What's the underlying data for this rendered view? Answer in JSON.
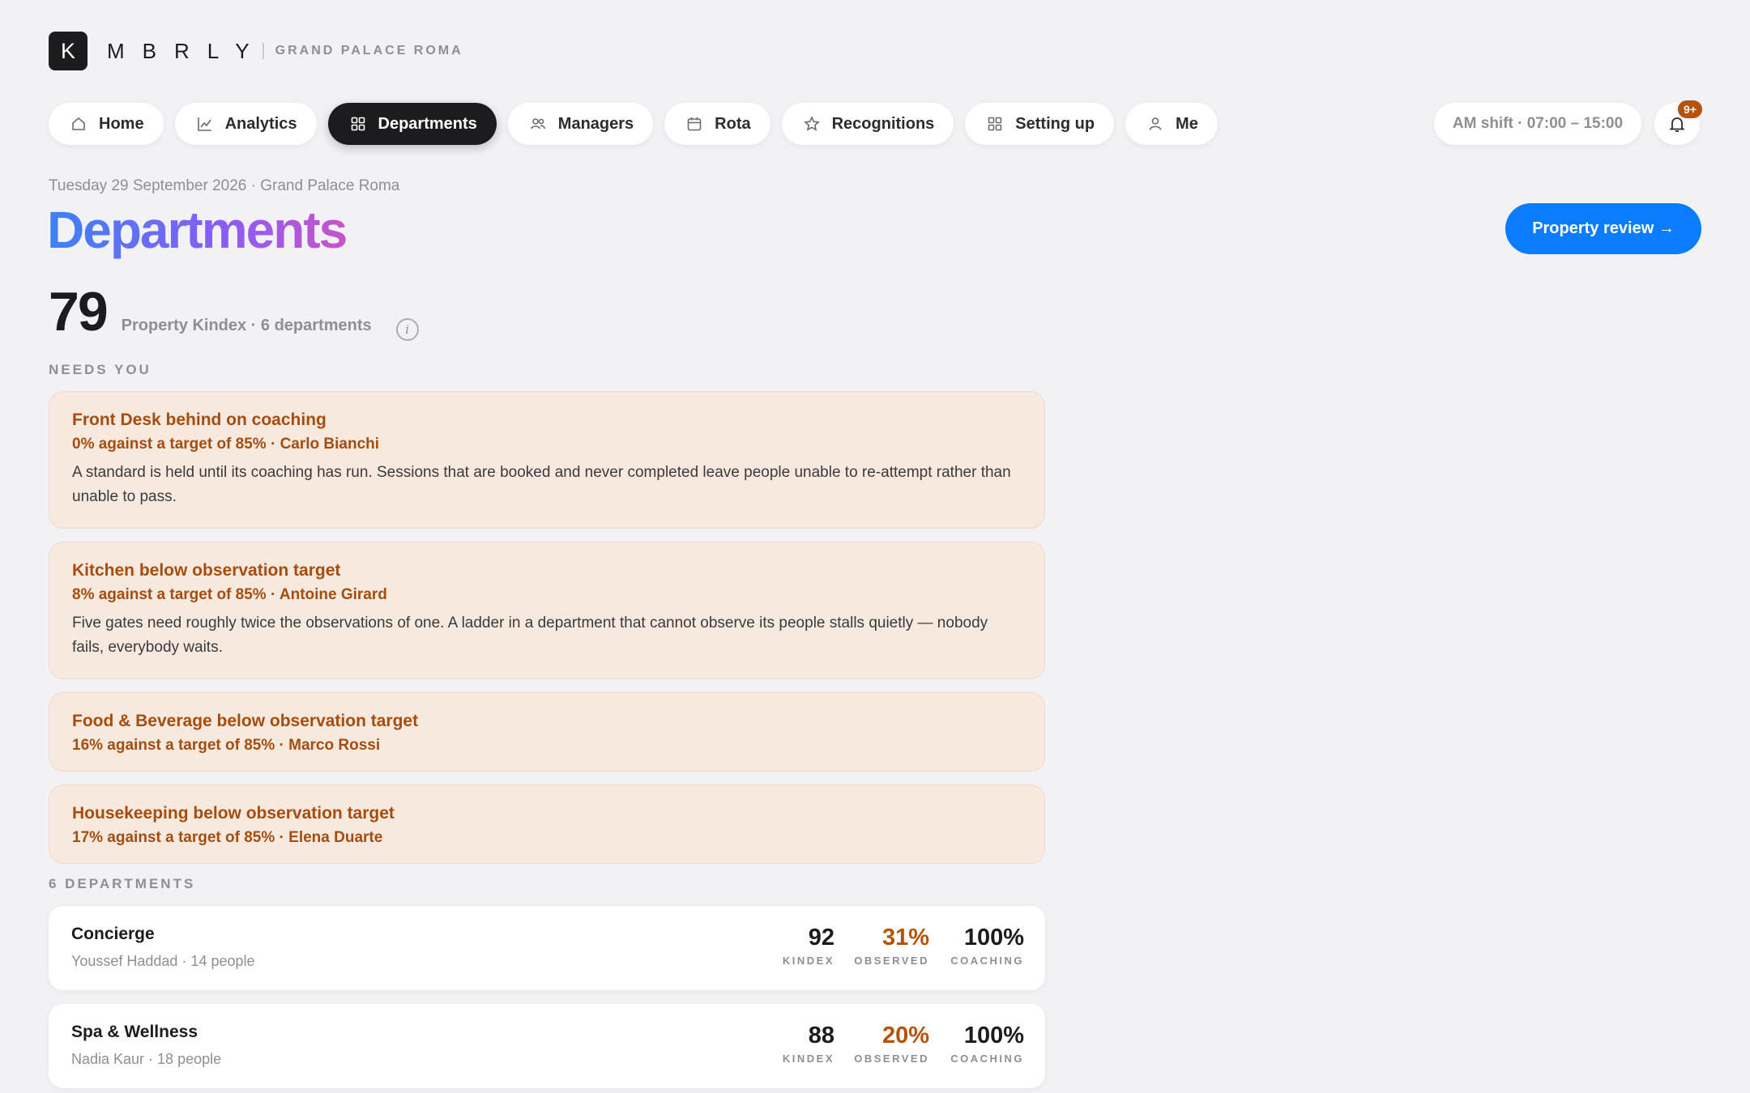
{
  "brand": {
    "logo_letter": "K",
    "wordmark": "MBRLY",
    "property": "GRAND PALACE ROMA"
  },
  "nav": {
    "items": [
      {
        "label": "Home",
        "icon": "home-icon",
        "active": false
      },
      {
        "label": "Analytics",
        "icon": "chart-icon",
        "active": false
      },
      {
        "label": "Departments",
        "icon": "grid-icon",
        "active": true
      },
      {
        "label": "Managers",
        "icon": "people-icon",
        "active": false
      },
      {
        "label": "Rota",
        "icon": "calendar-icon",
        "active": false
      },
      {
        "label": "Recognitions",
        "icon": "star-icon",
        "active": false
      },
      {
        "label": "Setting up",
        "icon": "grid-icon",
        "active": false
      },
      {
        "label": "Me",
        "icon": "person-icon",
        "active": false
      }
    ],
    "shift": "AM shift · 07:00 – 15:00",
    "notifications_badge": "9+"
  },
  "header": {
    "dateline": "Tuesday 29 September 2026 · Grand Palace Roma",
    "title": "Departments",
    "review_button": "Property review →"
  },
  "summary": {
    "kindex": "79",
    "label": "Property Kindex · 6 departments",
    "info_glyph": "i"
  },
  "needs_you": {
    "label": "NEEDS YOU",
    "alerts": [
      {
        "title": "Front Desk behind on coaching",
        "subtitle": "0% against a target of 85% · Carlo Bianchi",
        "body": "A standard is held until its coaching has run. Sessions that are booked and never completed leave people unable to re-attempt rather than unable to pass."
      },
      {
        "title": "Kitchen below observation target",
        "subtitle": "8% against a target of 85% · Antoine Girard",
        "body": "Five gates need roughly twice the observations of one. A ladder in a department that cannot observe its people stalls quietly — nobody fails, everybody waits."
      },
      {
        "title": "Food & Beverage below observation target",
        "subtitle": "16% against a target of 85% · Marco Rossi",
        "body": ""
      },
      {
        "title": "Housekeeping below observation target",
        "subtitle": "17% against a target of 85% · Elena Duarte",
        "body": ""
      }
    ]
  },
  "departments": {
    "label": "6 DEPARTMENTS",
    "metric_labels": {
      "kindex": "KINDEX",
      "observed": "OBSERVED",
      "coaching": "COACHING"
    },
    "items": [
      {
        "name": "Concierge",
        "meta": "Youssef Haddad · 14 people",
        "kindex": "92",
        "observed": "31%",
        "coaching": "100%"
      },
      {
        "name": "Spa & Wellness",
        "meta": "Nadia Kaur · 18 people",
        "kindex": "88",
        "observed": "20%",
        "coaching": "100%"
      }
    ]
  },
  "colors": {
    "accent": "#0a7cff",
    "warning": "#b45309",
    "alert_bg": "#f8e9df",
    "title_gradient": [
      "#3b82f6",
      "#8b5cf6",
      "#c855c8"
    ]
  }
}
